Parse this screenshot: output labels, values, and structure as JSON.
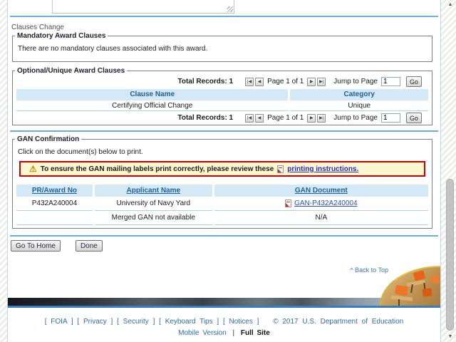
{
  "clauses_section": {
    "label": "Clauses Change"
  },
  "mandatory": {
    "legend": "Mandatory Award Clauses",
    "empty_text": "There are no mandatory clauses associated with this award."
  },
  "optional": {
    "legend": "Optional/Unique Award Clauses",
    "pager": {
      "total_label": "Total Records: 1",
      "first_icon": "|◀",
      "prev_icon": "◀",
      "next_icon": "▶",
      "last_icon": "▶|",
      "page_label": "Page 1 of 1",
      "jump_label": "Jump to Page",
      "jump_value": "1",
      "go_label": "Go"
    },
    "table": {
      "headers": [
        "Clause Name",
        "Category"
      ],
      "rows": [
        {
          "clause": "Certifying Official Change",
          "category": "Unique"
        }
      ]
    }
  },
  "gan": {
    "legend": "GAN Confirmation",
    "instruction": "Click on the document(s) below to print.",
    "warning": {
      "icon": "⚠",
      "text": "To ensure the GAN mailing labels print correctly, please review these",
      "link": "printing instructions."
    },
    "table": {
      "headers": [
        "PR/Award No",
        "Applicant Name",
        "GAN Document"
      ],
      "rows": [
        {
          "pr_award_no": "P432A240004",
          "applicant_name": "University of Navy Yard",
          "gan_document": "GAN-P432A240004"
        },
        {
          "pr_award_no": "",
          "applicant_name": "Merged GAN not available",
          "gan_document": "N/A"
        }
      ]
    }
  },
  "actions": {
    "go_home": "Go To Home",
    "done": "Done"
  },
  "back_to_top": "^ Back to Top",
  "footer": {
    "links": [
      "[ FOIA ]",
      "[ Privacy ]",
      "[ Security ]",
      "[ Keyboard Tips ]",
      "[ Notices ]"
    ],
    "copyright": "© 2017 U.S. Department of Education",
    "mobile_version": "Mobile Version",
    "divider": "|",
    "full_site": "Full Site"
  },
  "scrollbar": {
    "up_icon": "▲",
    "down_icon": "▼"
  },
  "colors": {
    "divider_blue": "#74abd6",
    "table_header_bg": "#d3e9f6",
    "table_header_text": "#1f5fa8",
    "warning_bg": "#fbf7cf",
    "warning_border": "#cc0000",
    "link_blue": "#2a2ac9",
    "footer_link_blue": "#2f6cab",
    "footer_blue_bar": "#3a7cc0"
  }
}
